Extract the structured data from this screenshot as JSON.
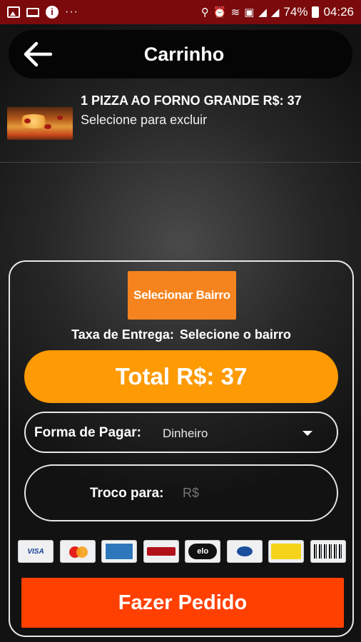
{
  "status_bar": {
    "battery": "74%",
    "time": "04:26",
    "more": "···"
  },
  "header": {
    "title": "Carrinho"
  },
  "cart": {
    "items": [
      {
        "name": "1 PIZZA AO FORNO GRANDE R$: 37",
        "hint": "Selecione para excluir"
      }
    ]
  },
  "checkout": {
    "bairro_button": "Selecionar Bairro",
    "taxa_label": "Taxa de Entrega:",
    "taxa_value": "Selecione o bairro",
    "total": "Total R$: 37",
    "payment_label": "Forma de Pagar:",
    "payment_value": "Dinheiro",
    "change_label": "Troco para:",
    "change_placeholder": "R$",
    "order_button": "Fazer Pedido"
  },
  "payment_cards": [
    "visa-card-icon",
    "mastercard-icon",
    "amex-card-icon",
    "hipercard-icon",
    "elo-card-icon",
    "diners-card-icon",
    "sodexo-card-icon",
    "boleto-barcode-icon"
  ],
  "payment_card_texts": {
    "visa": "VISA",
    "elo": "elo"
  },
  "colors": {
    "status_bar": "#7a0a0c",
    "bairro_button": "#f5841f",
    "total_pill": "#fd9a04",
    "order_button": "#ff4000"
  }
}
